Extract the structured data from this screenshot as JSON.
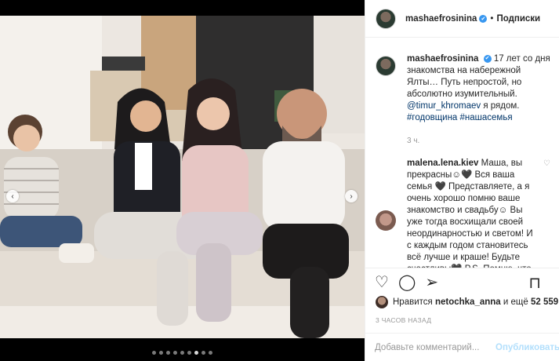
{
  "post": {
    "username": "mashaefrosinina",
    "follow_label": "Подписки",
    "separator": "•",
    "verified_glyph": "✔",
    "carousel": {
      "slide_count": 9,
      "active_slide": 7,
      "prev_glyph": "‹",
      "next_glyph": "›"
    }
  },
  "caption": {
    "author": "mashaefrosinina",
    "text": "17 лет со дня знакомства на набережной Ялты… Путь непростой, но абсолютно изумительный.",
    "mention": "@timur_khromaev",
    "text_after_mention": "я рядом.",
    "tags": "#годовщина #нашасемья",
    "time": "3 ч."
  },
  "comment": {
    "author": "malena.lena.kiev",
    "text": "Маша, вы прекрасны☺🖤 Вся ваша семья 🖤 Представляете, а я очень хорошо помню ваше знакомство и свадьбу☺ Вы уже тогда восхищали своей неординарностью и светом! И с каждым годом становитесь всё лучше и краше! Будьте счастливы🖤 P.S. Помню, что в то время имя Тимур было",
    "like_glyph": "♡"
  },
  "actions": {
    "like_glyph": "♡",
    "comment_glyph": "◯",
    "share_glyph": "➢",
    "save_glyph": "⊓"
  },
  "likes": {
    "prefix": "Нравится",
    "user": "netochka_anna",
    "middle": "и ещё",
    "count": "52 559"
  },
  "date": "3 ЧАСОВ НАЗАД",
  "add_comment": {
    "placeholder": "Добавьте комментарий...",
    "publish_label": "Опубликовать"
  },
  "icons": [
    "verified-icon",
    "heart-icon",
    "comment-icon",
    "share-icon",
    "bookmark-icon",
    "chevron-left-icon",
    "chevron-right-icon"
  ],
  "colors": {
    "link": "#003569",
    "verified": "#3897f0",
    "publish_disabled": "#b2dffc",
    "muted": "#999999"
  }
}
